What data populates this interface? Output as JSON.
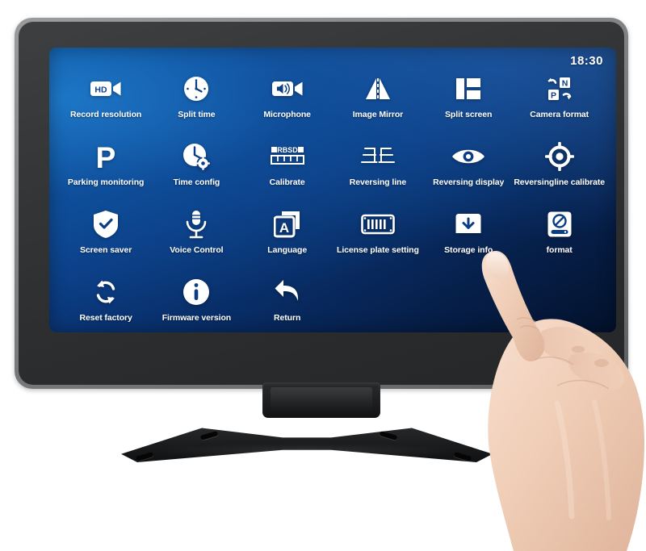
{
  "device": {
    "type": "car-dvr-touchscreen-monitor",
    "bezel_color": "#7d7f81",
    "frame_color": "#2c2e30"
  },
  "screen": {
    "background_colors": [
      "#1168b4",
      "#0b3d84",
      "#03122c"
    ],
    "status_bar": {
      "time": "18:30"
    },
    "menu": {
      "rows": 4,
      "columns": 6,
      "items": [
        {
          "label": "Record resolution",
          "icon": "hd-camcorder-icon"
        },
        {
          "label": "Split time",
          "icon": "clock-icon"
        },
        {
          "label": "Microphone",
          "icon": "audio-camcorder-icon"
        },
        {
          "label": "Image Mirror",
          "icon": "image-mirror-icon"
        },
        {
          "label": "Split screen",
          "icon": "split-screen-icon"
        },
        {
          "label": "Camera format",
          "icon": "np-format-icon"
        },
        {
          "label": "Parking monitoring",
          "icon": "parking-p-icon"
        },
        {
          "label": "Time config",
          "icon": "clock-gear-icon"
        },
        {
          "label": "Calibrate",
          "icon": "rbsd-ruler-icon"
        },
        {
          "label": "Reversing line",
          "icon": "reversing-line-icon"
        },
        {
          "label": "Reversing display",
          "icon": "eye-icon"
        },
        {
          "label": "Reversingline calibrate",
          "icon": "crosshair-icon"
        },
        {
          "label": "Screen saver",
          "icon": "shield-check-icon"
        },
        {
          "label": "Voice Control",
          "icon": "microphone-icon"
        },
        {
          "label": "Language",
          "icon": "language-a-icon"
        },
        {
          "label": "License plate setting",
          "icon": "license-plate-icon"
        },
        {
          "label": "Storage info",
          "icon": "storage-download-icon"
        },
        {
          "label": "format",
          "icon": "disk-forbidden-icon"
        },
        {
          "label": "Reset factory",
          "icon": "refresh-cycle-icon"
        },
        {
          "label": "Firmware version",
          "icon": "info-circle-icon"
        },
        {
          "label": "Return",
          "icon": "back-arrow-icon"
        }
      ]
    }
  },
  "stand": {
    "neck": "rectangular-neck",
    "base": "x-shaped-mounting-plate",
    "mounting_holes": 4
  },
  "hand": {
    "description": "right-hand-index-finger-pointing",
    "skin_color": "#f0cdb6"
  }
}
